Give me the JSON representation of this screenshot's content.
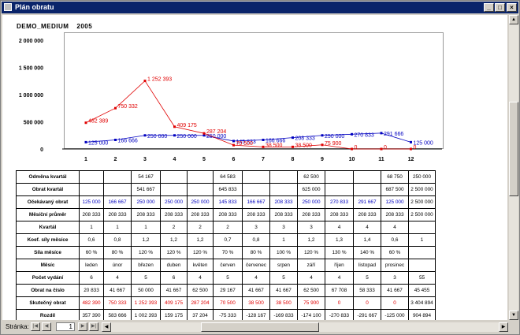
{
  "window": {
    "title": "Plán obratu",
    "minimize": "_",
    "restore": "□",
    "close": "×"
  },
  "report": {
    "name": "DEMO_MEDIUM",
    "year": "2005"
  },
  "footer": {
    "page_label": "Stránka:",
    "page_value": "1"
  },
  "colors": {
    "expected": "#0000c0",
    "actual": "#e00000",
    "title_bar": "#0a246a"
  },
  "chart_data": {
    "type": "line",
    "categories": [
      "1",
      "2",
      "3",
      "4",
      "5",
      "6",
      "7",
      "8",
      "9",
      "10",
      "11",
      "12"
    ],
    "ylim": [
      0,
      2000000
    ],
    "y_ticks": [
      "0",
      "500 000",
      "1 000 000",
      "1 500 000",
      "2 000 000"
    ],
    "y_tick_values": [
      0,
      500000,
      1000000,
      1500000,
      2000000
    ],
    "series": [
      {
        "key": "expected",
        "values": [
          125000,
          166667,
          250000,
          250000,
          250000,
          145833,
          166667,
          208333,
          250000,
          270833,
          291667,
          125000
        ],
        "labels": [
          "125 000",
          "166 666",
          "250 000",
          "250 000",
          "250 000",
          "145 833",
          "166 666",
          "208 333",
          "250 000",
          "270 833",
          "291 666",
          "125 000"
        ]
      },
      {
        "key": "actual",
        "values": [
          482390,
          750333,
          1252393,
          409175,
          287204,
          70500,
          38500,
          38500,
          75900,
          0,
          0,
          0
        ],
        "labels": [
          "482 389",
          "750 332",
          "1 252 393",
          "409 175",
          "287 204",
          "70 500",
          "38 500",
          "38 500",
          "75 900",
          "0",
          "0",
          "0"
        ]
      }
    ]
  },
  "table": {
    "rows": [
      {
        "label": "Odměna kvartál",
        "style": "",
        "cells": [
          "",
          "",
          "54 167",
          "",
          "",
          "64 583",
          "",
          "",
          "62 500",
          "",
          "",
          "68 750",
          "250 000"
        ]
      },
      {
        "label": "Obrat kvartál",
        "style": "",
        "cells": [
          "",
          "",
          "541 667",
          "",
          "",
          "645 833",
          "",
          "",
          "625 000",
          "",
          "",
          "687 500",
          "2 500 000"
        ]
      },
      {
        "label": "Očekávaný obrat",
        "style": "blue",
        "cells": [
          "125 000",
          "166 667",
          "250 000",
          "250 000",
          "250 000",
          "145 833",
          "166 667",
          "208 333",
          "250 000",
          "270 833",
          "291 667",
          "125 000",
          "2 500 000"
        ]
      },
      {
        "label": "Měsíční průměr",
        "style": "",
        "cells": [
          "208 333",
          "208 333",
          "208 333",
          "208 333",
          "208 333",
          "208 333",
          "208 333",
          "208 333",
          "208 333",
          "208 333",
          "208 333",
          "208 333",
          "2 500 000"
        ]
      },
      {
        "label": "Kvartál",
        "style": "",
        "cells": [
          "1",
          "1",
          "1",
          "2",
          "2",
          "2",
          "3",
          "3",
          "3",
          "4",
          "4",
          "4",
          ""
        ]
      },
      {
        "label": "Koef. síly měsíce",
        "style": "",
        "cells": [
          "0,6",
          "0,8",
          "1,2",
          "1,2",
          "1,2",
          "0,7",
          "0,8",
          "1",
          "1,2",
          "1,3",
          "1,4",
          "0,6",
          "1"
        ]
      },
      {
        "label": "Síla měsíce",
        "style": "",
        "cells": [
          "60 %",
          "80 %",
          "120 %",
          "120 %",
          "120 %",
          "70 %",
          "80 %",
          "100 %",
          "120 %",
          "130 %",
          "140 %",
          "60 %",
          ""
        ]
      },
      {
        "label": "Měsíc",
        "style": "",
        "cells": [
          "leden",
          "únor",
          "březen",
          "duben",
          "květen",
          "červen",
          "červenec",
          "srpen",
          "září",
          "říjen",
          "listopad",
          "prosinec",
          ""
        ]
      },
      {
        "label": "Počet vydání",
        "style": "",
        "cells": [
          "6",
          "4",
          "5",
          "6",
          "4",
          "5",
          "4",
          "5",
          "4",
          "4",
          "5",
          "3",
          "55"
        ]
      },
      {
        "label": "Obrat na číslo",
        "style": "",
        "cells": [
          "20 833",
          "41 667",
          "50 000",
          "41 667",
          "62 500",
          "29 167",
          "41 667",
          "41 667",
          "62 500",
          "67 708",
          "58 333",
          "41 667",
          "45 455"
        ]
      },
      {
        "label": "Skutečný obrat",
        "style": "red",
        "cells": [
          "482 390",
          "750 333",
          "1 252 393",
          "409 175",
          "287 204",
          "70 500",
          "38 500",
          "38 500",
          "75 900",
          "0",
          "0",
          "0",
          "3 404 894"
        ]
      },
      {
        "label": "Rozdíl",
        "style": "",
        "cells": [
          "357 390",
          "583 666",
          "1 002 393",
          "159 175",
          "37 204",
          "-75 333",
          "-128 167",
          "-169 833",
          "-174 100",
          "-270 833",
          "-291 667",
          "-125 000",
          "904 894"
        ]
      }
    ]
  }
}
